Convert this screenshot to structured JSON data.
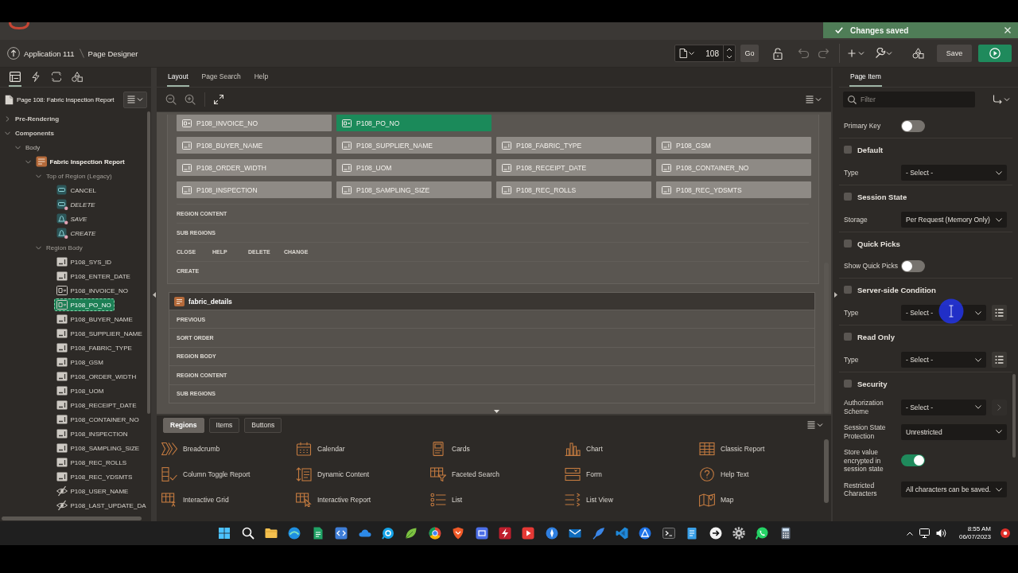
{
  "top_bar": {
    "toast": {
      "message": "Changes saved"
    }
  },
  "breadcrumb": {
    "items": [
      "Application 111",
      "Page Designer"
    ]
  },
  "page_toolbar": {
    "page_number": "108",
    "go": "Go",
    "save": "Save"
  },
  "left_pane": {
    "tabs": [
      {
        "kind": "rendering",
        "selected": true
      },
      {
        "kind": "dynamic",
        "selected": false
      },
      {
        "kind": "processing",
        "selected": false
      },
      {
        "kind": "shared",
        "selected": false
      }
    ],
    "title": "Page 108: Fabric Inspection Report",
    "tree": [
      {
        "label": "Pre-Rendering",
        "kind": "root",
        "expanded": false,
        "selected": false
      },
      {
        "label": "Components",
        "kind": "root",
        "expanded": true,
        "selected": false,
        "children": [
          {
            "label": "Body",
            "kind": "section",
            "expanded": true,
            "selected": false,
            "children": [
              {
                "label": "Fabric Inspection Report",
                "kind": "region",
                "expanded": true,
                "selected": false,
                "children": [
                  {
                    "label": "Top of Region (Legacy)",
                    "kind": "position",
                    "expanded": true,
                    "selected": false,
                    "children": [
                      {
                        "label": "CANCEL",
                        "kind": "button",
                        "conditional": false,
                        "selected": false
                      },
                      {
                        "label": "DELETE",
                        "kind": "button",
                        "conditional": true,
                        "selected": false
                      },
                      {
                        "label": "SAVE",
                        "kind": "hot",
                        "conditional": true,
                        "selected": false
                      },
                      {
                        "label": "CREATE",
                        "kind": "hot",
                        "conditional": true,
                        "selected": false
                      }
                    ]
                  },
                  {
                    "label": "Region Body",
                    "kind": "position",
                    "expanded": true,
                    "selected": false,
                    "children": [
                      {
                        "label": "P108_SYS_ID",
                        "kind": "text",
                        "selected": false
                      },
                      {
                        "label": "P108_ENTER_DATE",
                        "kind": "text",
                        "selected": false
                      },
                      {
                        "label": "P108_INVOICE_NO",
                        "kind": "popup",
                        "selected": false
                      },
                      {
                        "label": "P108_PO_NO",
                        "kind": "popup",
                        "selected": true
                      },
                      {
                        "label": "P108_BUYER_NAME",
                        "kind": "text",
                        "selected": false
                      },
                      {
                        "label": "P108_SUPPLIER_NAME",
                        "kind": "text",
                        "selected": false
                      },
                      {
                        "label": "P108_FABRIC_TYPE",
                        "kind": "text",
                        "selected": false
                      },
                      {
                        "label": "P108_GSM",
                        "kind": "text",
                        "selected": false
                      },
                      {
                        "label": "P108_ORDER_WIDTH",
                        "kind": "text",
                        "selected": false
                      },
                      {
                        "label": "P108_UOM",
                        "kind": "text",
                        "selected": false
                      },
                      {
                        "label": "P108_RECEIPT_DATE",
                        "kind": "text",
                        "selected": false
                      },
                      {
                        "label": "P108_CONTAINER_NO",
                        "kind": "text",
                        "selected": false
                      },
                      {
                        "label": "P108_INSPECTION",
                        "kind": "text",
                        "selected": false
                      },
                      {
                        "label": "P108_SAMPLING_SIZE",
                        "kind": "text",
                        "selected": false
                      },
                      {
                        "label": "P108_REC_ROLLS",
                        "kind": "text",
                        "selected": false
                      },
                      {
                        "label": "P108_REC_YDSMTS",
                        "kind": "text",
                        "selected": false
                      },
                      {
                        "label": "P108_USER_NAME",
                        "kind": "hidden",
                        "selected": false
                      },
                      {
                        "label": "P108_LAST_UPDATE_DA",
                        "kind": "hidden",
                        "selected": false
                      }
                    ]
                  }
                ]
              }
            ]
          }
        ]
      }
    ]
  },
  "center_pane": {
    "tabs": [
      {
        "label": "Layout",
        "selected": true
      },
      {
        "label": "Page Search",
        "selected": false
      },
      {
        "label": "Help",
        "selected": false
      }
    ],
    "canvas": {
      "item_rows": [
        [
          {
            "label": "P108_INVOICE_NO",
            "kind": "popup",
            "selected": false
          },
          {
            "label": "P108_PO_NO",
            "kind": "popup",
            "selected": true
          }
        ],
        [
          {
            "label": "P108_BUYER_NAME",
            "kind": "text",
            "selected": false
          },
          {
            "label": "P108_SUPPLIER_NAME",
            "kind": "text",
            "selected": false
          },
          {
            "label": "P108_FABRIC_TYPE",
            "kind": "text",
            "selected": false
          },
          {
            "label": "P108_GSM",
            "kind": "text",
            "selected": false
          }
        ],
        [
          {
            "label": "P108_ORDER_WIDTH",
            "kind": "text",
            "selected": false
          },
          {
            "label": "P108_UOM",
            "kind": "text",
            "selected": false
          },
          {
            "label": "P108_RECEIPT_DATE",
            "kind": "text",
            "selected": false
          },
          {
            "label": "P108_CONTAINER_NO",
            "kind": "text",
            "selected": false
          }
        ],
        [
          {
            "label": "P108_INSPECTION",
            "kind": "text",
            "selected": false
          },
          {
            "label": "P108_SAMPLING_SIZE",
            "kind": "text",
            "selected": false
          },
          {
            "label": "P108_REC_ROLLS",
            "kind": "text",
            "selected": false
          },
          {
            "label": "P108_REC_YDSMTS",
            "kind": "text",
            "selected": false
          }
        ]
      ],
      "position_rows": [
        [
          "REGION CONTENT"
        ],
        [
          "SUB REGIONS"
        ],
        [
          "CLOSE",
          "HELP",
          "DELETE",
          "CHANGE"
        ],
        [
          "CREATE"
        ]
      ],
      "sub_region": {
        "title": "fabric_details",
        "positions": [
          "PREVIOUS",
          "SORT ORDER",
          "REGION BODY",
          "REGION CONTENT",
          "SUB REGIONS"
        ]
      }
    }
  },
  "gallery": {
    "tabs": [
      {
        "label": "Regions",
        "selected": true
      },
      {
        "label": "Items",
        "selected": false
      },
      {
        "label": "Buttons",
        "selected": false
      }
    ],
    "items": [
      {
        "label": "Breadcrumb",
        "kind": "breadcrumb"
      },
      {
        "label": "Calendar",
        "kind": "calendar"
      },
      {
        "label": "Cards",
        "kind": "cards"
      },
      {
        "label": "Chart",
        "kind": "chart"
      },
      {
        "label": "Classic Report",
        "kind": "table"
      },
      {
        "label": "Column Toggle Report",
        "kind": "toggle"
      },
      {
        "label": "Dynamic Content",
        "kind": "dynamic"
      },
      {
        "label": "Faceted Search",
        "kind": "faceted"
      },
      {
        "label": "Form",
        "kind": "form"
      },
      {
        "label": "Help Text",
        "kind": "help"
      },
      {
        "label": "Interactive Grid",
        "kind": "grid"
      },
      {
        "label": "Interactive Report",
        "kind": "interactive"
      },
      {
        "label": "List",
        "kind": "list"
      },
      {
        "label": "List View",
        "kind": "listview"
      },
      {
        "label": "Map",
        "kind": "map"
      }
    ]
  },
  "right_pane": {
    "tabs": [
      {
        "label": "Page Item",
        "selected": true
      }
    ],
    "filter": {
      "placeholder": "Filter"
    },
    "properties": [
      {
        "kind": "switch",
        "label": "Primary Key",
        "on": false
      },
      {
        "kind": "group",
        "label": "Default"
      },
      {
        "kind": "select",
        "label": "Type",
        "value": "- Select -"
      },
      {
        "kind": "group",
        "label": "Session State"
      },
      {
        "kind": "select",
        "label": "Storage",
        "value": "Per Request (Memory Only)"
      },
      {
        "kind": "group",
        "label": "Quick Picks"
      },
      {
        "kind": "switch",
        "label": "Show Quick Picks",
        "on": false
      },
      {
        "kind": "group",
        "label": "Server-side Condition"
      },
      {
        "kind": "select",
        "label": "Type",
        "value": "- Select -",
        "action": {
          "kind": "list",
          "disabled": false
        }
      },
      {
        "kind": "group",
        "label": "Read Only"
      },
      {
        "kind": "select",
        "label": "Type",
        "value": "- Select -",
        "action": {
          "kind": "list",
          "disabled": false
        }
      },
      {
        "kind": "group",
        "label": "Security"
      },
      {
        "kind": "select",
        "label": "Authorization Scheme",
        "value": "- Select -",
        "action": {
          "kind": "next",
          "disabled": true
        }
      },
      {
        "kind": "select",
        "label": "Session State Protection",
        "value": "Unrestricted"
      },
      {
        "kind": "switch",
        "label": "Store value encrypted in session state",
        "on": true
      },
      {
        "kind": "select",
        "label": "Restricted Characters",
        "value": "All characters can be saved."
      }
    ]
  },
  "taskbar": {
    "time": "8:55 AM",
    "date": "06/07/2023"
  }
}
